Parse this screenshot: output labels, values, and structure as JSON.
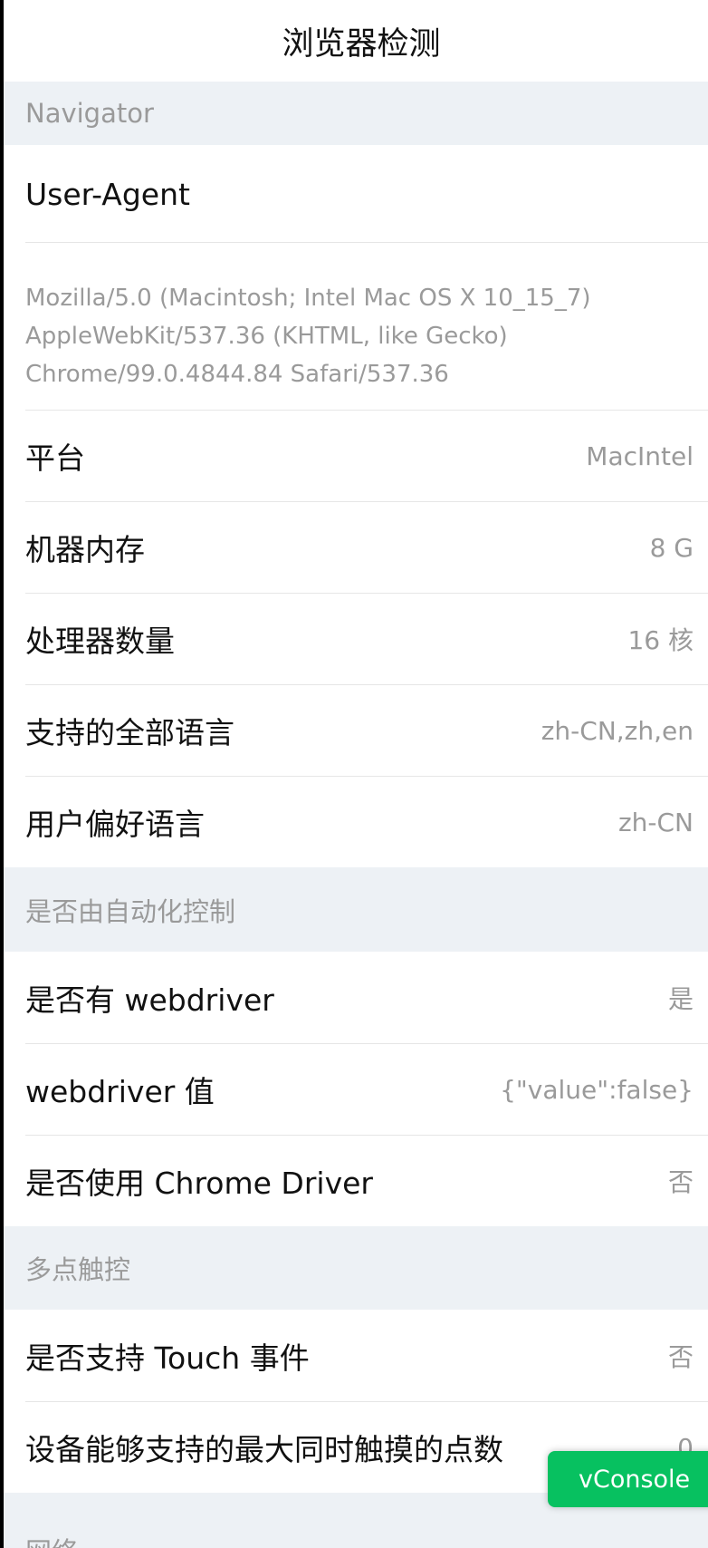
{
  "header": {
    "title": "浏览器检测"
  },
  "sections": {
    "navigator": "Navigator",
    "automation": "是否由自动化控制",
    "touch": "多点触控",
    "network": "网络"
  },
  "user_agent": {
    "label": "User-Agent",
    "line1": "Mozilla/5.0 (Macintosh; Intel Mac OS X 10_15_7)",
    "line2": "AppleWebKit/537.36 (KHTML, like Gecko)",
    "line3": "Chrome/99.0.4844.84 Safari/537.36"
  },
  "navigator_rows": [
    {
      "label": "平台",
      "value": "MacIntel"
    },
    {
      "label": "机器内存",
      "value": "8 G"
    },
    {
      "label": "处理器数量",
      "value": "16 核"
    },
    {
      "label": "支持的全部语言",
      "value": "zh-CN,zh,en"
    },
    {
      "label": "用户偏好语言",
      "value": "zh-CN"
    }
  ],
  "automation_rows": [
    {
      "label": "是否有 webdriver",
      "value": "是"
    },
    {
      "label": "webdriver 值",
      "value": "{\"value\":false}"
    },
    {
      "label": "是否使用 Chrome Driver",
      "value": "否"
    }
  ],
  "touch_rows": [
    {
      "label": "是否支持 Touch 事件",
      "value": "否"
    },
    {
      "label": "设备能够支持的最大同时触摸的点数",
      "value": "0"
    }
  ],
  "vconsole": {
    "label": "vConsole"
  }
}
